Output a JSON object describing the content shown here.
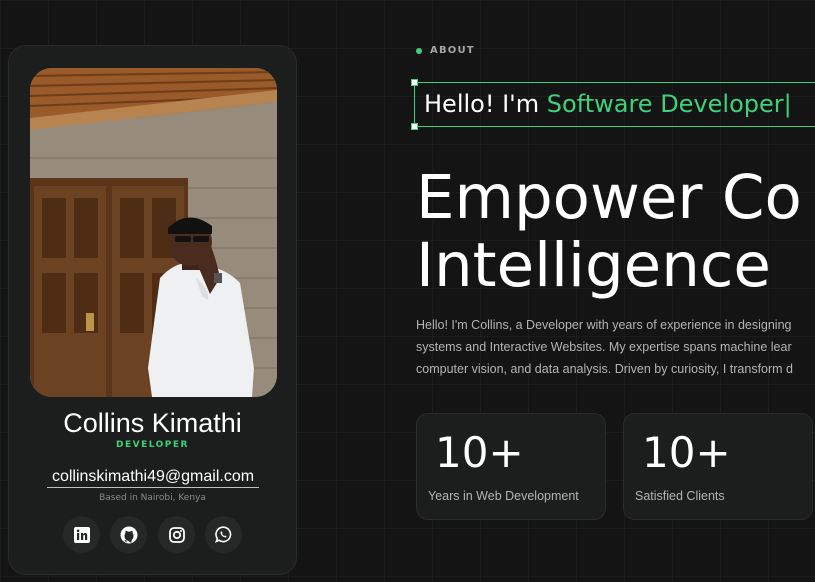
{
  "profile": {
    "name": "Collins Kimathi",
    "role": "DEVELOPER",
    "email": "collinskimathi49@gmail.com",
    "location": "Based in Nairobi, Kenya",
    "socials": [
      {
        "icon": "linkedin-icon"
      },
      {
        "icon": "github-icon"
      },
      {
        "icon": "instagram-icon"
      },
      {
        "icon": "whatsapp-icon"
      }
    ]
  },
  "about": {
    "label": "ABOUT",
    "typing_prefix": "Hello! I'm ",
    "typing_accent": "Software Developer",
    "typing_cursor": "|",
    "headline_line1": "Empower Co",
    "headline_line2": "Intelligence",
    "intro_lines": [
      "Hello! I'm Collins, a Developer with years of experience in designing",
      "systems and Interactive Websites. My expertise spans machine lear",
      "computer vision, and data analysis. Driven by curiosity, I transform d"
    ]
  },
  "stats": [
    {
      "value": "10+",
      "label": "Years in Web Development"
    },
    {
      "value": "10+",
      "label": "Satisfied Clients"
    }
  ],
  "colors": {
    "accent": "#3ed17a",
    "background": "#141414",
    "card": "#1c1d1d"
  }
}
